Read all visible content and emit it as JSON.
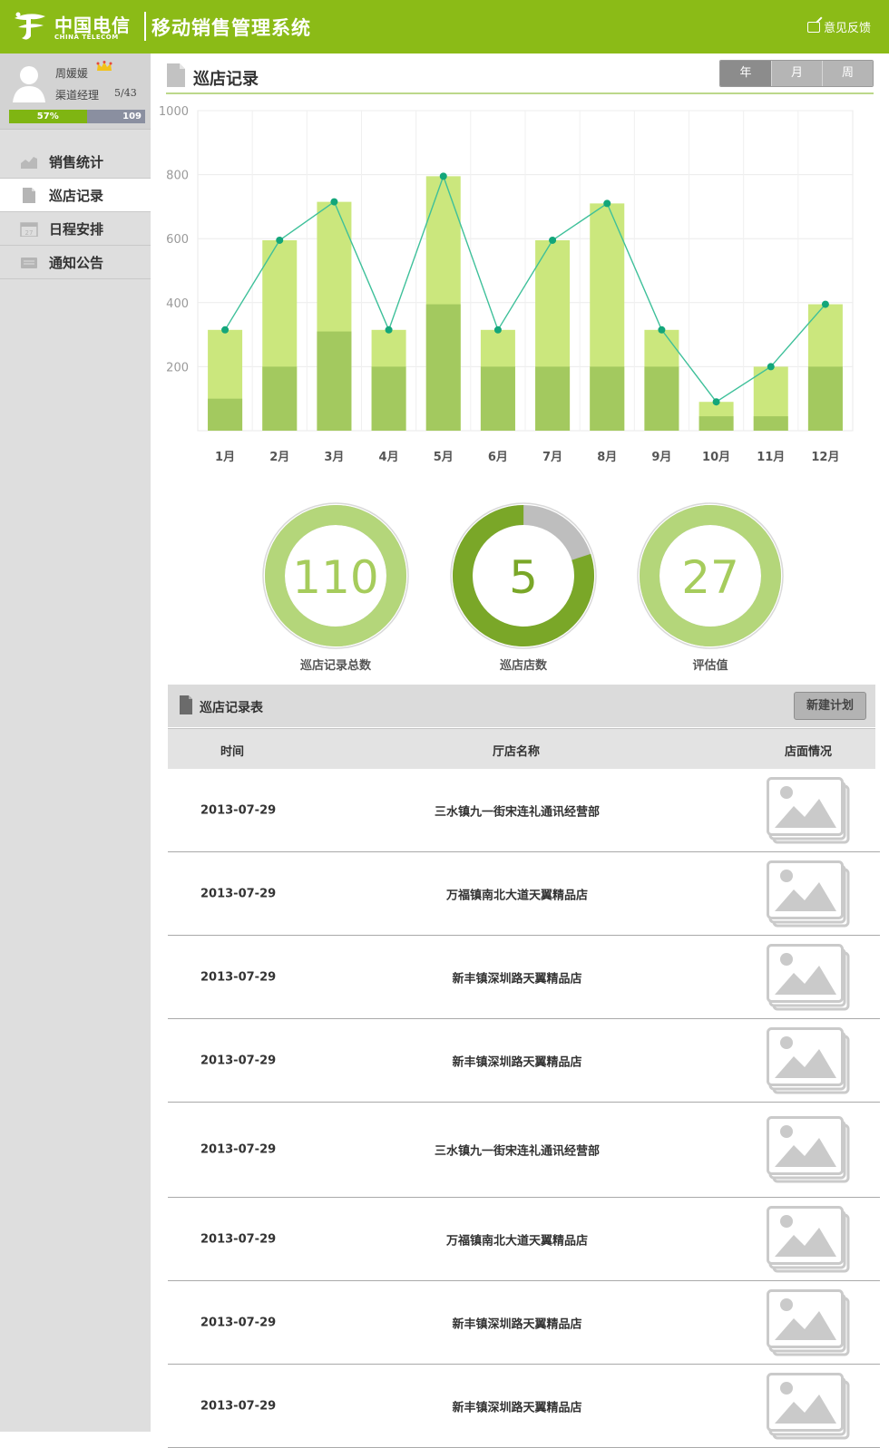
{
  "header": {
    "logo_cn": "中国电信",
    "logo_en": "CHINA TELECOM",
    "app_title": "移动销售管理系统",
    "feedback_label": "意见反馈"
  },
  "user": {
    "name": "周媛媛",
    "role": "渠道经理",
    "rank": "5/43",
    "progress_label": "57%",
    "progress_fraction": 0.57,
    "total": "109"
  },
  "nav": {
    "items": [
      {
        "label": "销售统计",
        "icon": "chart-icon"
      },
      {
        "label": "巡店记录",
        "icon": "document-icon",
        "active": true
      },
      {
        "label": "日程安排",
        "icon": "calendar-icon"
      },
      {
        "label": "通知公告",
        "icon": "message-icon"
      }
    ]
  },
  "section": {
    "title": "巡店记录",
    "period_tabs": [
      "年",
      "月",
      "周"
    ],
    "active_tab": "年"
  },
  "chart_data": {
    "type": "bar",
    "categories": [
      "1月",
      "2月",
      "3月",
      "4月",
      "5月",
      "6月",
      "7月",
      "8月",
      "9月",
      "10月",
      "11月",
      "12月"
    ],
    "ylim": [
      0,
      1000
    ],
    "yticks": [
      "200",
      "400",
      "600",
      "800",
      "1000"
    ],
    "grid": true,
    "series": [
      {
        "kind": "stacked-bar-lower",
        "values": [
          100,
          200,
          310,
          200,
          395,
          200,
          200,
          200,
          200,
          45,
          45,
          200
        ],
        "color": "#a3c95f"
      },
      {
        "kind": "stacked-bar-total",
        "values": [
          315,
          595,
          715,
          315,
          795,
          315,
          595,
          710,
          315,
          90,
          200,
          395
        ],
        "color": "#cbe77d"
      },
      {
        "kind": "line",
        "values": [
          315,
          595,
          715,
          315,
          795,
          315,
          595,
          710,
          315,
          90,
          200,
          395
        ],
        "color": "#3ec09a"
      }
    ]
  },
  "stats": [
    {
      "value": "110",
      "label": "巡店记录总数",
      "fraction": 1.0,
      "color": "#b4d67a"
    },
    {
      "value": "5",
      "label": "巡店店数",
      "fraction": 0.8,
      "color": "#7aa728"
    },
    {
      "value": "27",
      "label": "评估值",
      "fraction": 1.0,
      "color": "#b4d67a"
    }
  ],
  "table": {
    "title": "巡店记录表",
    "new_button": "新建计划",
    "columns": [
      "时间",
      "厅店名称",
      "店面情况"
    ],
    "rows": [
      {
        "date": "2013-07-29",
        "store": "三水镇九一街宋连礼通讯经营部"
      },
      {
        "date": "2013-07-29",
        "store": "万福镇南北大道天翼精品店"
      },
      {
        "date": "2013-07-29",
        "store": "新丰镇深圳路天翼精品店"
      },
      {
        "date": "2013-07-29",
        "store": "新丰镇深圳路天翼精品店"
      },
      {
        "date": "2013-07-29",
        "store": "三水镇九一街宋连礼通讯经营部"
      },
      {
        "date": "2013-07-29",
        "store": "万福镇南北大道天翼精品店"
      },
      {
        "date": "2013-07-29",
        "store": "新丰镇深圳路天翼精品店"
      },
      {
        "date": "2013-07-29",
        "store": "新丰镇深圳路天翼精品店"
      }
    ]
  }
}
